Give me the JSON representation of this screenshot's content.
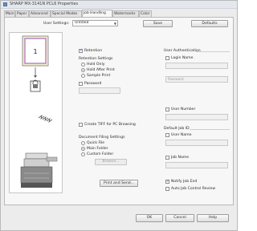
{
  "window": {
    "title": "SHARP MX-3141N PCL6 Properties"
  },
  "tabs": [
    {
      "label": "Main"
    },
    {
      "label": "Paper"
    },
    {
      "label": "Advanced"
    },
    {
      "label": "Special Modes"
    },
    {
      "label": "Job Handling"
    },
    {
      "label": "Watermarks"
    },
    {
      "label": "Color"
    }
  ],
  "active_tab": "Job Handling",
  "user_settings": {
    "label": "User Settings:",
    "value": "Untitled",
    "save_label": "Save",
    "defaults_label": "Defaults"
  },
  "preview": {
    "page_number": "1",
    "icons": [
      "document-icon",
      "lock-icon",
      "wireless-icon",
      "printer-icon"
    ]
  },
  "retention": {
    "retention_label": "Retention",
    "retention_checked": true,
    "settings_label": "Retention Settings",
    "options": [
      {
        "label": "Hold Only",
        "selected": false
      },
      {
        "label": "Hold After Print",
        "selected": true
      },
      {
        "label": "Sample Print",
        "selected": false
      }
    ],
    "password_label": "Password",
    "password_checked": false
  },
  "create_tiff_label": "Create TIFF for PC Browsing",
  "create_tiff_checked": false,
  "filing": {
    "group_label": "Document Filing Settings",
    "options": [
      {
        "label": "Quick File",
        "selected": false
      },
      {
        "label": "Main Folder",
        "selected": true
      },
      {
        "label": "Custom Folder",
        "selected": false
      }
    ],
    "browse_label": "Browse...",
    "print_send_label": "Print and Send..."
  },
  "user_auth": {
    "group_label": "User Authentication",
    "login_name_label": "Login Name",
    "login_name_checked": false,
    "password_placeholder": "Password",
    "user_number_label": "User Number",
    "user_number_checked": false
  },
  "default_job_id": {
    "group_label": "Default Job ID",
    "user_name_label": "User Name",
    "user_name_checked": false,
    "job_name_label": "Job Name",
    "job_name_checked": false
  },
  "notify": {
    "notify_label": "Notify Job End",
    "notify_checked": true,
    "auto_control_label": "Auto Job Control Review",
    "auto_control_checked": false
  },
  "footer": {
    "ok_label": "OK",
    "cancel_label": "Cancel",
    "help_label": "Help"
  },
  "colors": {
    "accent": "#1d4fa0",
    "window_bg": "#ececec",
    "panel_bg": "#f7f7f7"
  }
}
